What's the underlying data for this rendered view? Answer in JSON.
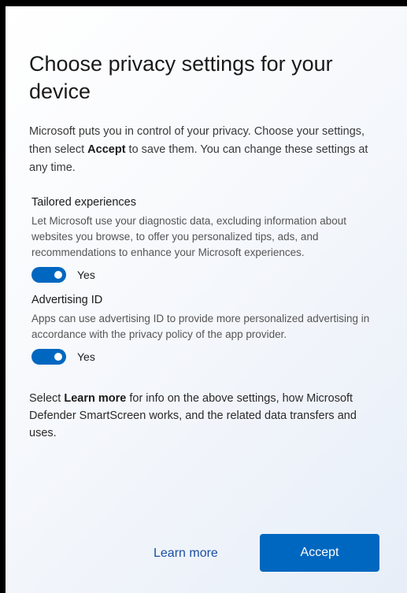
{
  "dialog": {
    "title": "Choose privacy settings for your device",
    "intro_before": "Microsoft puts you in control of your privacy. Choose your settings, then select ",
    "intro_bold": "Accept",
    "intro_after": " to save them. You can change these settings at any time."
  },
  "sections": [
    {
      "title": "Tailored experiences",
      "description": "Let Microsoft use your diagnostic data, excluding information about websites you browse, to offer you personalized tips, ads, and recommendations to enhance your Microsoft experiences.",
      "toggle_label": "Yes",
      "toggle_on": true
    },
    {
      "title": "Advertising ID",
      "description": "Apps can use advertising ID to provide more personalized advertising in accordance with the privacy policy of the app provider.",
      "toggle_label": "Yes",
      "toggle_on": true
    }
  ],
  "footer": {
    "note_before": "Select ",
    "note_bold": "Learn more",
    "note_after": " for info on the above settings, how Microsoft Defender SmartScreen works, and the related data transfers and uses."
  },
  "buttons": {
    "learn_more": "Learn more",
    "accept": "Accept"
  },
  "colors": {
    "accent": "#0067c0",
    "link": "#1a4fa0"
  }
}
